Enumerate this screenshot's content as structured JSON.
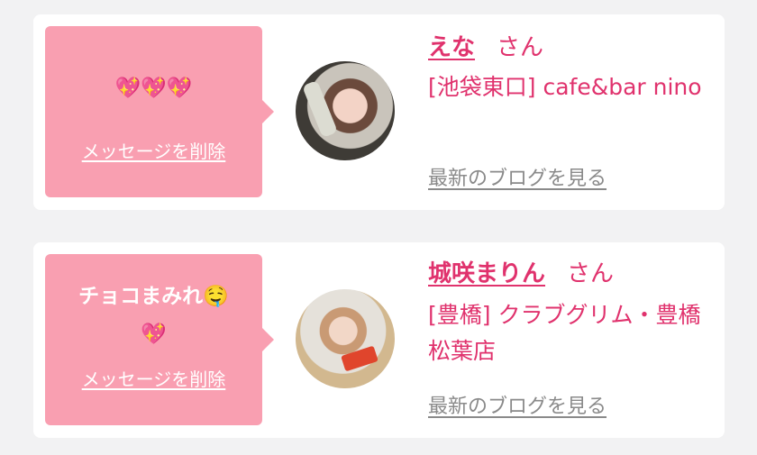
{
  "messages": [
    {
      "message": "💖💖💖",
      "delete_label": "メッセージを削除",
      "cast_name": "えな",
      "honorific": "さん",
      "shop": "[池袋東口] cafe&bar nino",
      "blog_label": "最新のブログを見る"
    },
    {
      "message": "チョコまみれ🤤💖",
      "delete_label": "メッセージを削除",
      "cast_name": "城咲まりん",
      "honorific": "さん",
      "shop": "[豊橋] クラブグリム・豊橋松葉店",
      "blog_label": "最新のブログを見る"
    }
  ],
  "colors": {
    "bubble": "#f99fb1",
    "accent_text": "#e0326d",
    "link_gray": "#8a8a8a",
    "background": "#f2f2f3"
  }
}
